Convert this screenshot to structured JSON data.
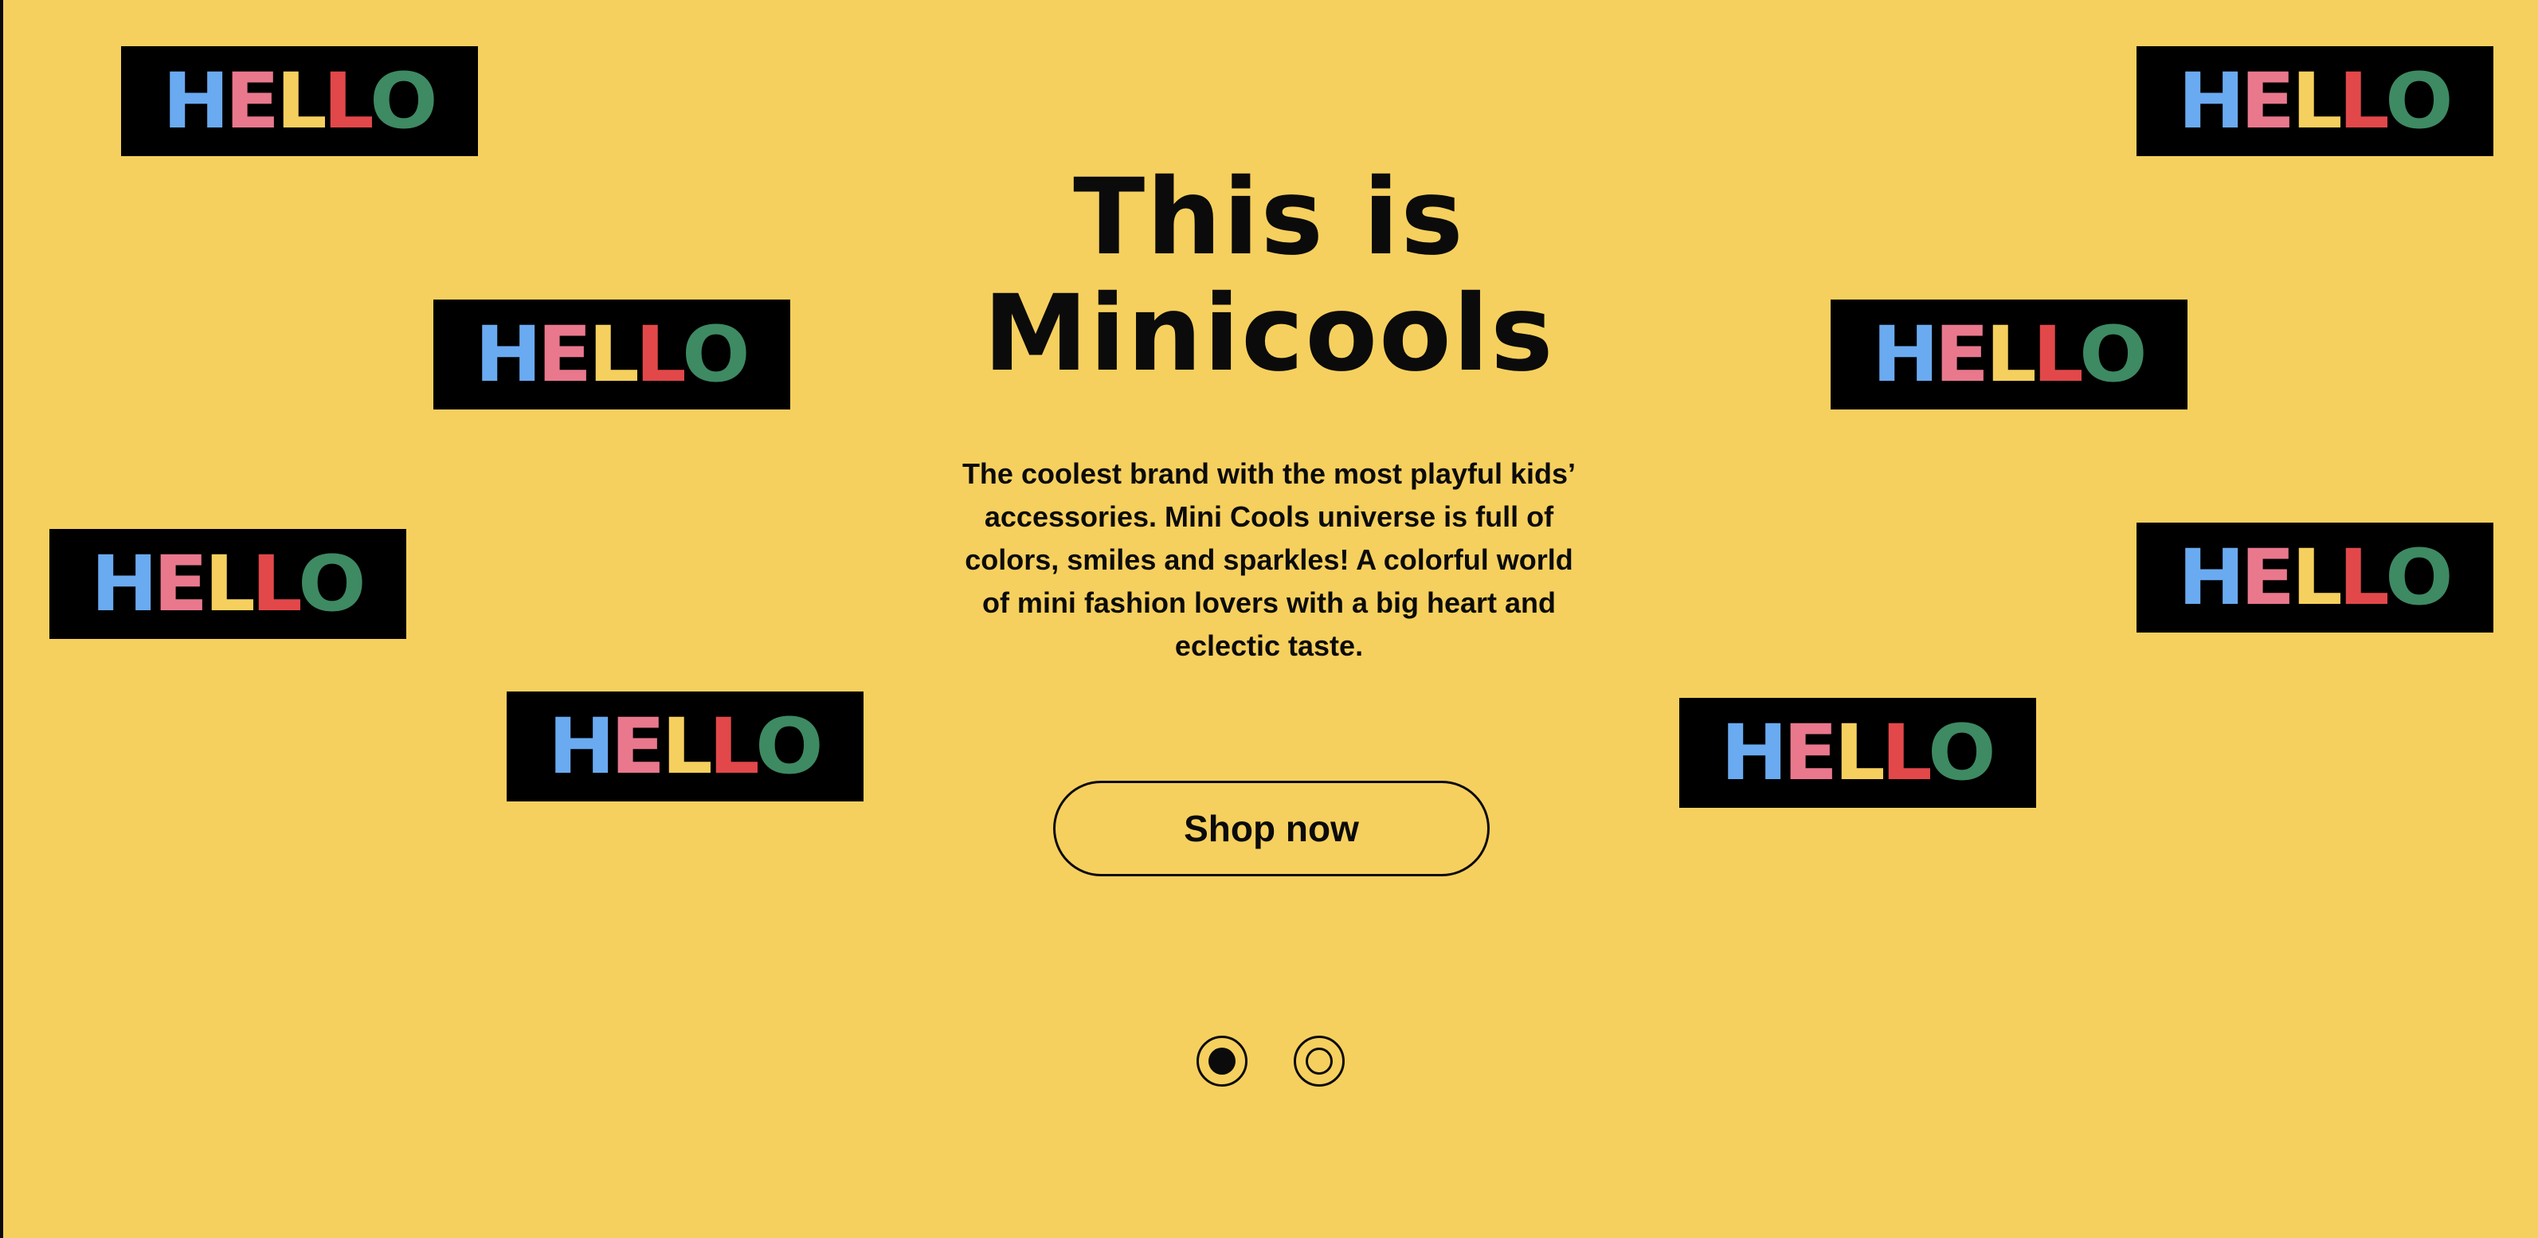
{
  "hero": {
    "title_line1": "This is",
    "title_line2": "Minicools",
    "description": "The coolest brand with the most playful kids’ accessories. Mini Cools universe is full of colors, smiles and sparkles! A colorful world of mini fashion lovers with a big heart and eclectic taste.",
    "cta_label": "Shop now"
  },
  "carousel": {
    "slides": 2,
    "active_index": 0
  },
  "sticker": {
    "letters": [
      {
        "char": "H",
        "color": "#6aaaf0"
      },
      {
        "char": "E",
        "color": "#e9788d"
      },
      {
        "char": "L",
        "color": "#f6d05e"
      },
      {
        "char": "L",
        "color": "#e2484a"
      },
      {
        "char": "O",
        "color": "#3e8a63"
      }
    ]
  },
  "colors": {
    "background": "#f6d05e",
    "ink": "#0b0b0b"
  }
}
